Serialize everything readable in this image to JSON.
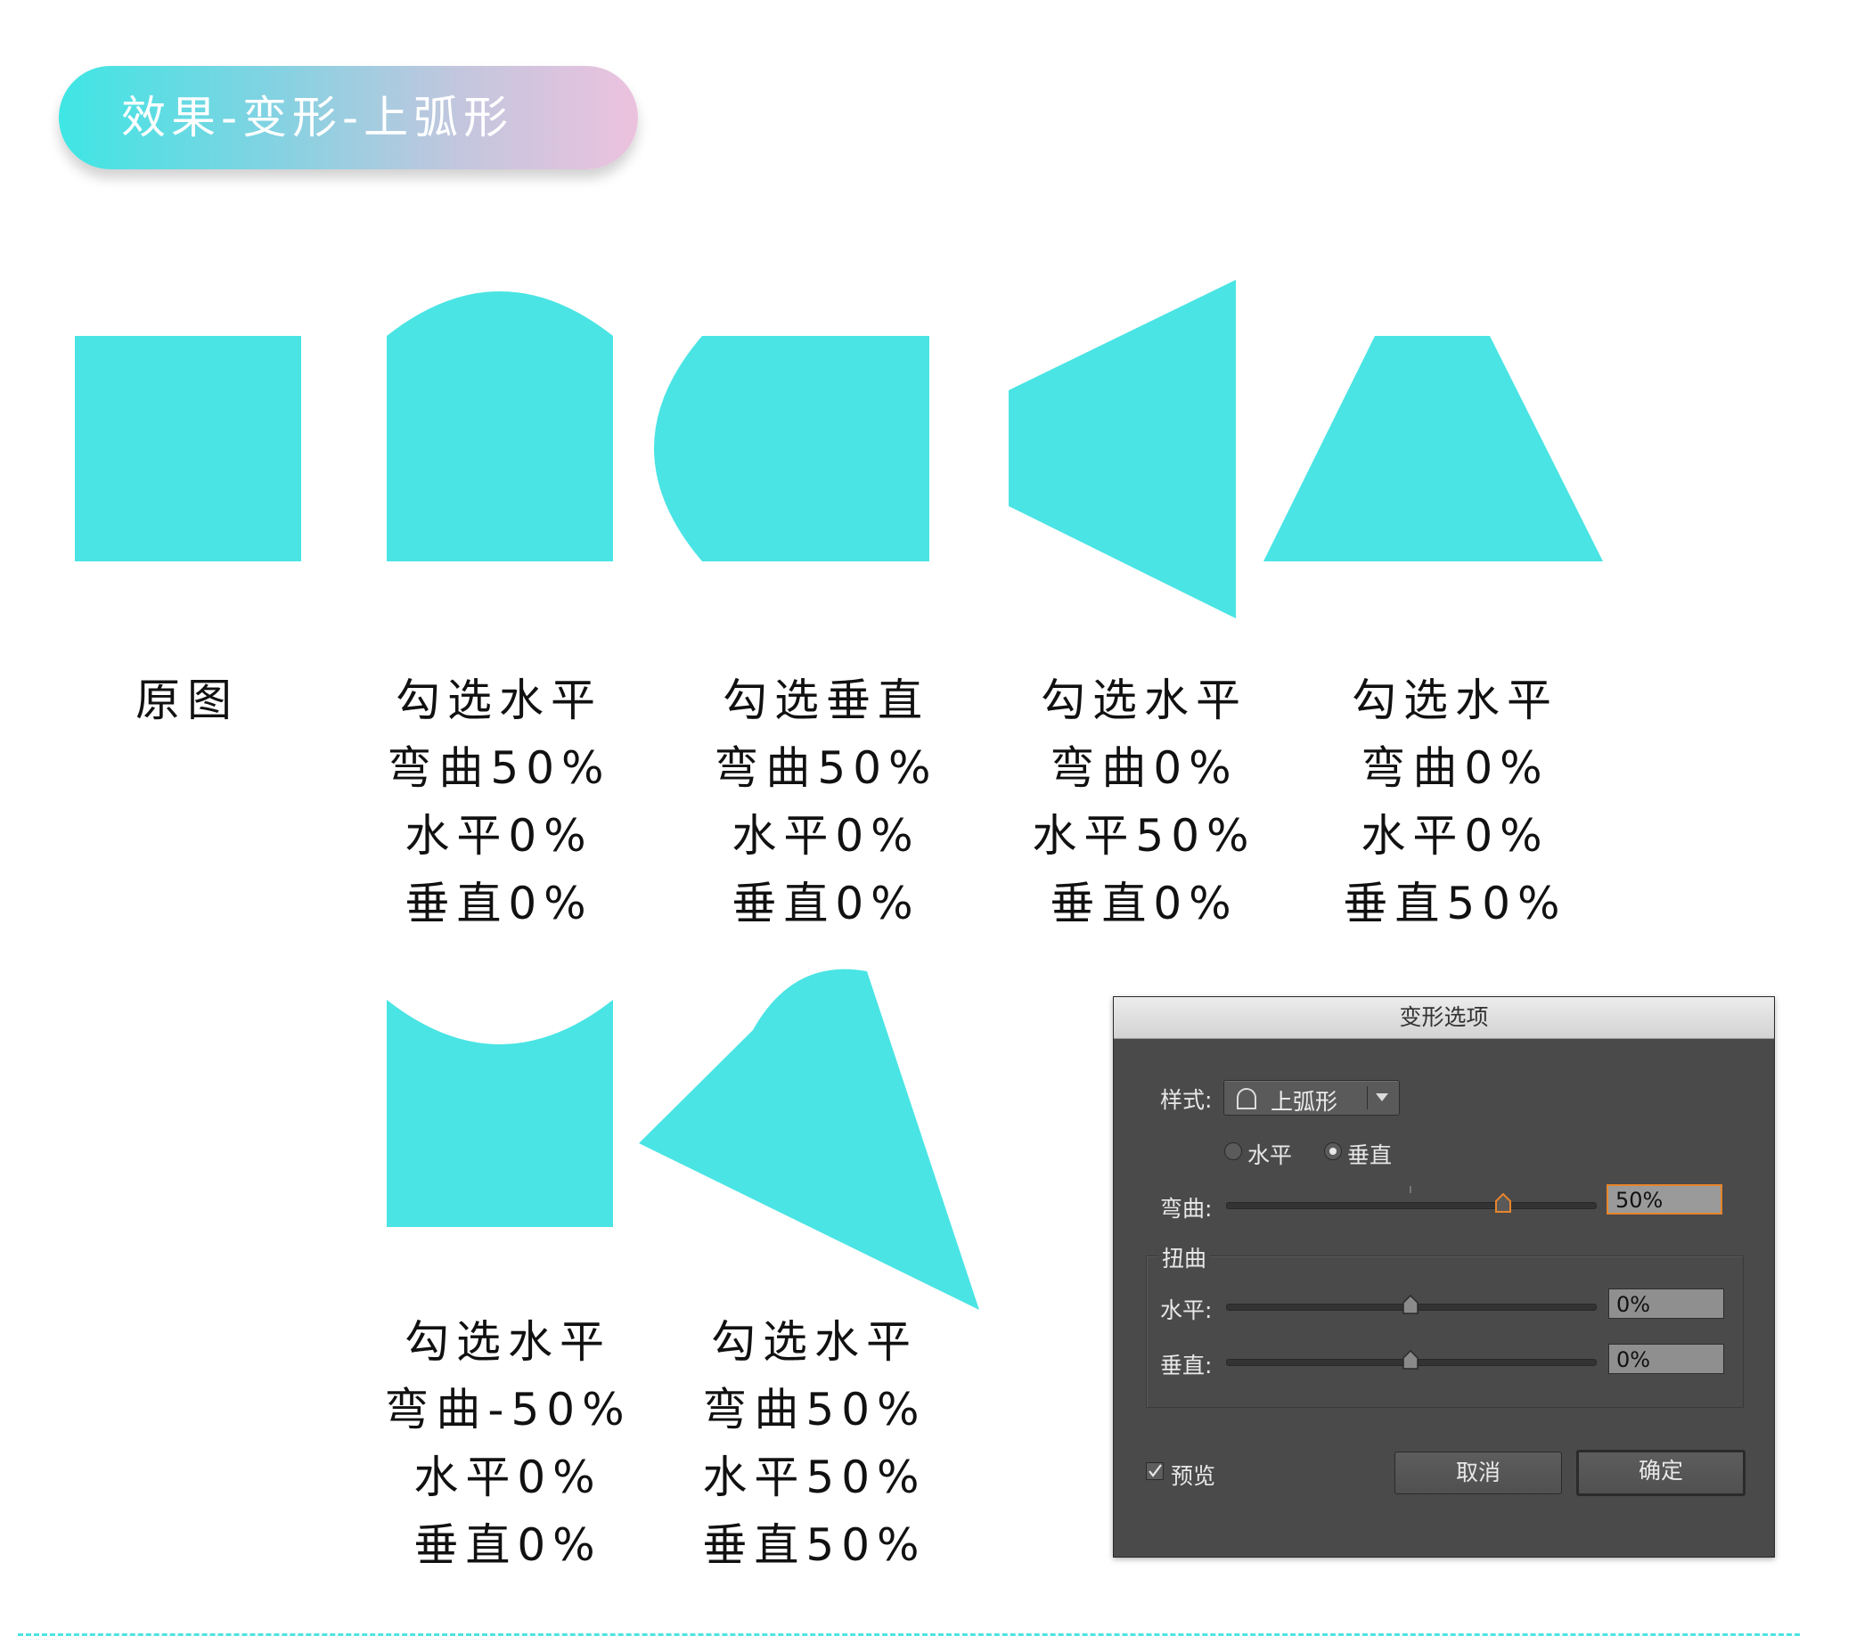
{
  "title": "效果-变形-上弧形",
  "shape_color": "#4ae4e4",
  "captions": [
    {
      "lines": [
        "原图"
      ]
    },
    {
      "lines": [
        "勾选水平",
        "弯曲50%",
        "水平0%",
        "垂直0%"
      ]
    },
    {
      "lines": [
        "勾选垂直",
        "弯曲50%",
        "水平0%",
        "垂直0%"
      ]
    },
    {
      "lines": [
        "勾选水平",
        "弯曲0%",
        "水平50%",
        "垂直0%"
      ]
    },
    {
      "lines": [
        "勾选水平",
        "弯曲0%",
        "水平0%",
        "垂直50%"
      ]
    },
    {
      "lines": [
        "勾选水平",
        "弯曲-50%",
        "水平0%",
        "垂直0%"
      ]
    },
    {
      "lines": [
        "勾选水平",
        "弯曲50%",
        "水平50%",
        "垂直50%"
      ]
    }
  ],
  "dialog": {
    "title": "变形选项",
    "style_label": "样式:",
    "style_value": "上弧形",
    "orientation": {
      "horizontal": "水平",
      "vertical": "垂直",
      "selected": "vertical"
    },
    "bend_label": "弯曲:",
    "bend_value": "50%",
    "bend_level": 0.75,
    "distortion_group": "扭曲",
    "horizontal_label": "水平:",
    "horizontal_value": "0%",
    "horizontal_level": 0.5,
    "vertical_label": "垂直:",
    "vertical_value": "0%",
    "vertical_level": 0.5,
    "preview_label": "预览",
    "preview_checked": true,
    "cancel_label": "取消",
    "ok_label": "确定"
  }
}
